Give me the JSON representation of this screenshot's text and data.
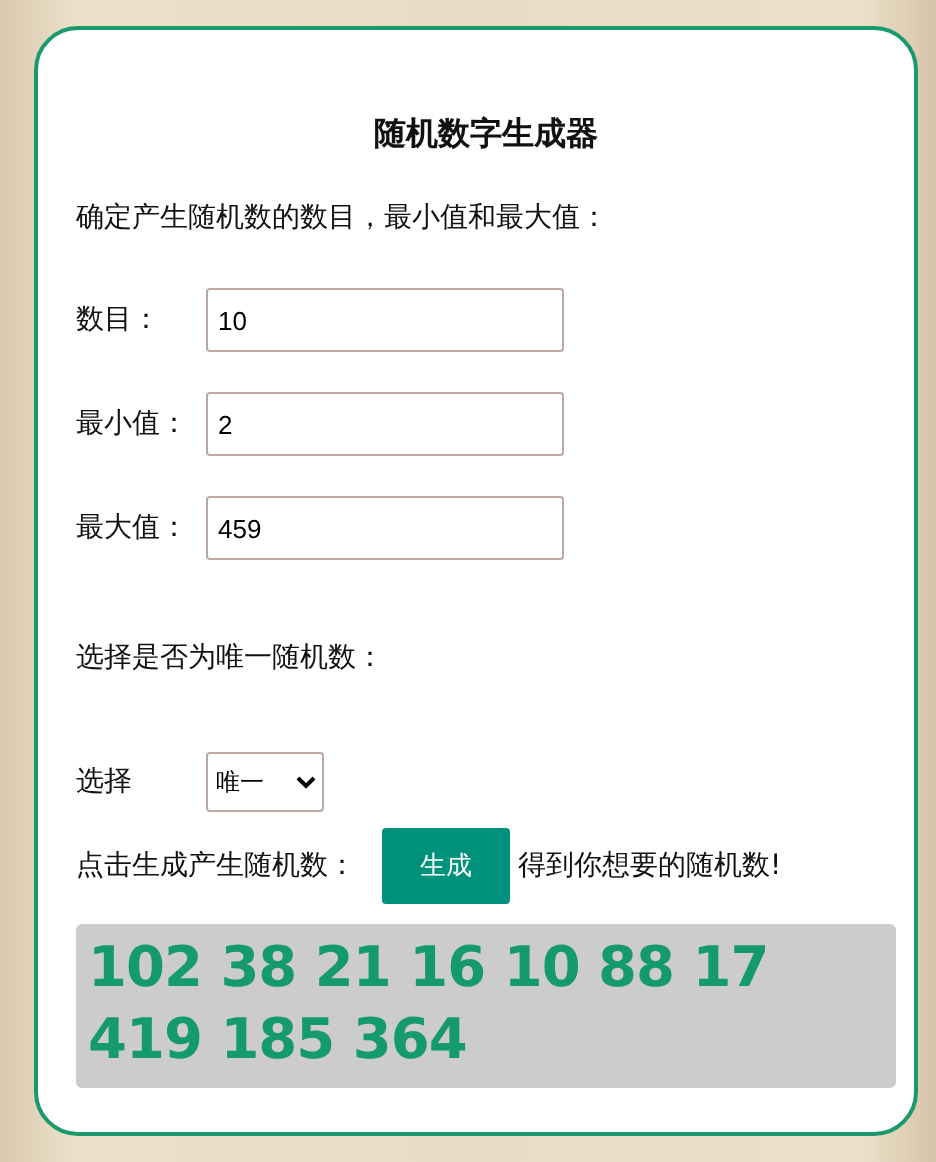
{
  "title": "随机数字生成器",
  "instruction": "确定产生随机数的数目，最小值和最大值：",
  "fields": [
    {
      "label": "数目：",
      "value": "10"
    },
    {
      "label": "最小值：",
      "value": "2"
    },
    {
      "label": "最大值：",
      "value": "459"
    }
  ],
  "unique_prompt": "选择是否为唯一随机数：",
  "select": {
    "label": "选择",
    "value": "唯一"
  },
  "generate": {
    "prompt": "点击生成产生随机数：",
    "button": "生成",
    "suffix": "得到你想要的随机数!"
  },
  "result": "102 38 21 16 10 88 17 419 185 364"
}
